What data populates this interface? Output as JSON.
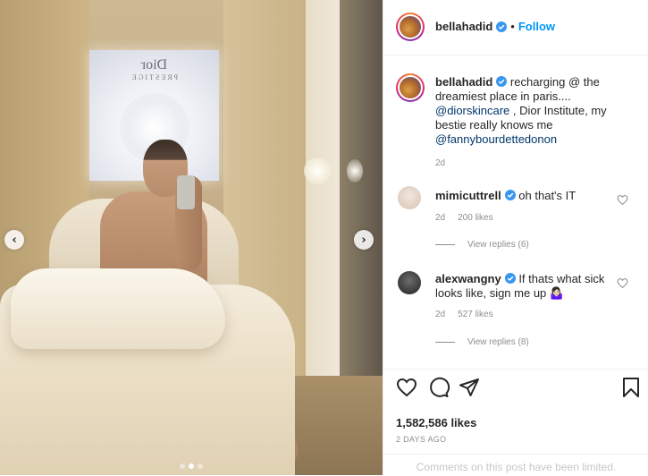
{
  "media": {
    "poster_brand": "Dior",
    "poster_sub": "PRESTIGE",
    "carousel_count": 3,
    "carousel_active_index": 1,
    "prev_glyph": "‹",
    "next_glyph": "›"
  },
  "header": {
    "username": "bellahadid",
    "verified": true,
    "separator": "•",
    "follow_label": "Follow"
  },
  "caption": {
    "username": "bellahadid",
    "text_1": " recharging @ the dreamiest place in paris.... ",
    "mention_1": "@diorskincare",
    "text_2": " , Dior Institute, my bestie really knows me ",
    "mention_2": "@fannybourdettedonon",
    "time": "2d"
  },
  "comments": [
    {
      "username": "mimicuttrell",
      "text": " oh that's IT",
      "time": "2d",
      "likes": "200 likes",
      "replies": "View replies (6)"
    },
    {
      "username": "alexwangny",
      "text": " If thats what sick looks like, sign me up 🤷🏻‍♀️",
      "time": "2d",
      "likes": "527 likes",
      "replies": "View replies (8)"
    }
  ],
  "actions": {
    "likes": "1,582,586 likes",
    "date": "2 DAYS AGO",
    "comments_limited": "Comments on this post have been limited."
  },
  "colors": {
    "link": "#0095f6",
    "mention": "#00376b",
    "muted": "#8e8e8e",
    "verified": "#3897f0"
  },
  "icons": [
    "chevron-left-icon",
    "chevron-right-icon",
    "verified-icon",
    "heart-icon",
    "comment-icon",
    "share-icon",
    "save-icon"
  ]
}
